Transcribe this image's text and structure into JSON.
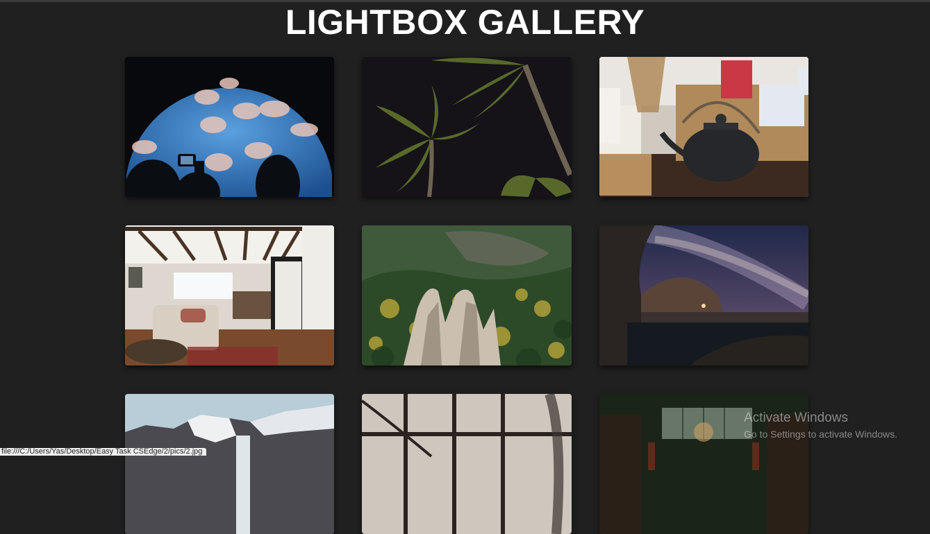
{
  "header": {
    "title": "LIGHTBOX GALLERY"
  },
  "gallery": {
    "images": [
      {
        "name": "jellyfish-aquarium"
      },
      {
        "name": "palm-trees-night"
      },
      {
        "name": "teapot-coffee-table"
      },
      {
        "name": "living-room-interior"
      },
      {
        "name": "forest-rocks-aerial"
      },
      {
        "name": "milky-way-cave"
      },
      {
        "name": "snowy-mountain-waterfall"
      },
      {
        "name": "window-frame-interior"
      },
      {
        "name": "library-hall"
      }
    ]
  },
  "status_bar": {
    "url": "file:///C:/Users/Yas/Desktop/Easy Task CSEdge/2/pics/2.jpg"
  },
  "watermark": {
    "title": "Activate Windows",
    "subtitle": "Go to Settings to activate Windows."
  },
  "colors": {
    "background": "#202020",
    "title": "#ffffff"
  }
}
